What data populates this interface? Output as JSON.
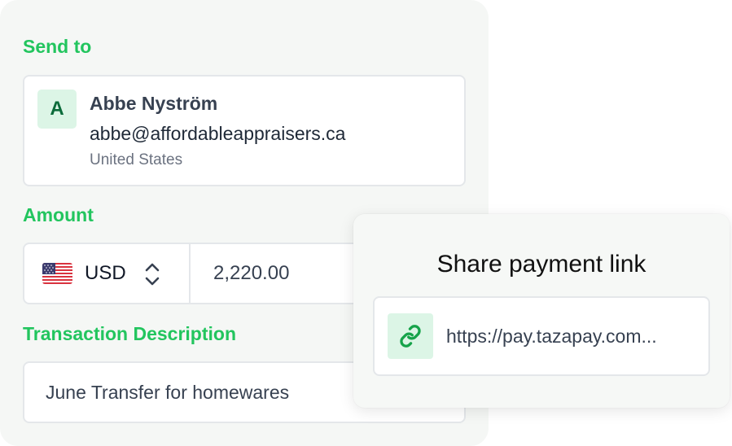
{
  "send_to": {
    "label": "Send to",
    "recipient": {
      "avatar_initial": "A",
      "name": "Abbe Nyström",
      "email": "abbe@affordableappraisers.ca",
      "country": "United States"
    }
  },
  "amount": {
    "label": "Amount",
    "currency": "USD",
    "flag_icon": "us-flag-icon",
    "value": "2,220.00"
  },
  "description": {
    "label": "Transaction Description",
    "value": "June Transfer for homewares"
  },
  "share": {
    "title": "Share payment link",
    "url": "https://pay.tazapay.com...",
    "link_icon": "link-icon"
  },
  "colors": {
    "accent": "#22c55e",
    "avatar_bg": "#dcf5e6",
    "avatar_text": "#0b6b3a"
  }
}
